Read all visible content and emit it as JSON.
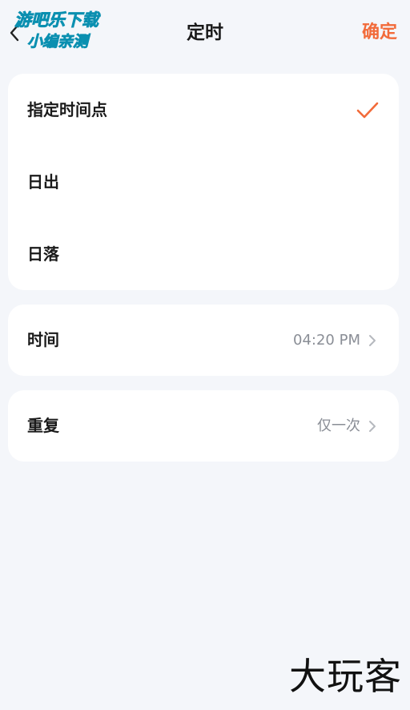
{
  "header": {
    "title": "定时",
    "confirm_label": "确定"
  },
  "watermark": {
    "line1": "游吧乐下载",
    "line2": "小编亲测",
    "accent_color": "#2fd3e6"
  },
  "options": [
    {
      "label": "指定时间点",
      "selected": true
    },
    {
      "label": "日出",
      "selected": false
    },
    {
      "label": "日落",
      "selected": false
    }
  ],
  "settings": {
    "time": {
      "label": "时间",
      "value": "04:20 PM"
    },
    "repeat": {
      "label": "重复",
      "value": "仅一次"
    }
  },
  "brand": {
    "text": "大玩客"
  },
  "colors": {
    "accent": "#f26b3a",
    "background": "#f4f6fa",
    "card": "#ffffff",
    "secondary_text": "#8a8e96"
  },
  "icons": {
    "back": "chevron-left-icon",
    "check": "checkmark-icon",
    "chevron": "chevron-right-icon"
  }
}
